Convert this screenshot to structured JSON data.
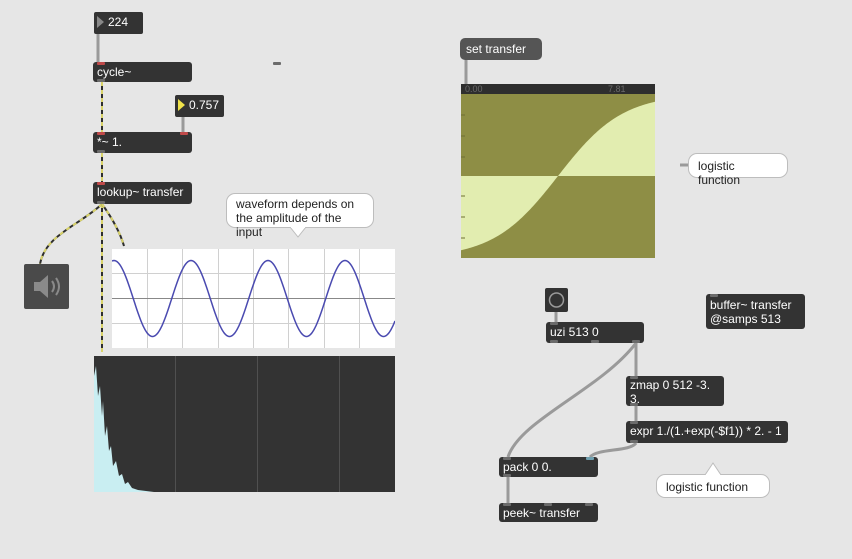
{
  "objects": {
    "number_224": "224",
    "cycle": "cycle~",
    "number_amp": "0.757",
    "mult": "*~ 1.",
    "lookup": "lookup~ transfer",
    "set_transfer": "set transfer",
    "uzi": "uzi 513 0",
    "buffer_line1": "buffer~ transfer",
    "buffer_line2": "@samps 513",
    "zmap_line1": "zmap 0 512 -3.",
    "zmap_line2": "3.",
    "expr": "expr 1./(1.+exp(-$f1)) * 2. - 1",
    "pack": "pack 0 0.",
    "peek": "peek~ transfer"
  },
  "comments": {
    "waveform_note": "waveform depends on the amplitude of the input",
    "logistic_1": "logistic function",
    "logistic_2": "logistic function"
  },
  "buffer_display": {
    "start_label": "0.00",
    "end_label": "7.81"
  },
  "icons": {
    "speaker": "speaker-icon",
    "bang": "bang-icon"
  },
  "colors": {
    "patch_bg": "#e6e6e6",
    "object_bg": "#333333",
    "signal_cord": "#c9c35a",
    "buffer_bg": "#8e8e45",
    "buffer_wave": "#e2edb0",
    "scope_line": "#4a4ab0",
    "spectrum_fill": "#c9eef2"
  }
}
